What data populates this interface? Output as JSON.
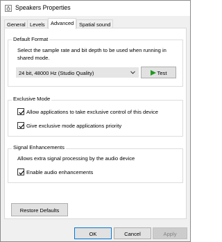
{
  "window": {
    "title": "Speakers Properties"
  },
  "tabs": [
    {
      "label": "General",
      "active": false
    },
    {
      "label": "Levels",
      "active": false
    },
    {
      "label": "Advanced",
      "active": true
    },
    {
      "label": "Spatial sound",
      "active": false
    }
  ],
  "default_format": {
    "title": "Default Format",
    "description": "Select the sample rate and bit depth to be used when running in shared mode.",
    "selected_format": "24 bit, 48000 Hz (Studio Quality)",
    "test_label": "Test"
  },
  "exclusive_mode": {
    "title": "Exclusive Mode",
    "options": [
      {
        "label": "Allow applications to take exclusive control of this device",
        "checked": true
      },
      {
        "label": "Give exclusive mode applications priority",
        "checked": true
      }
    ]
  },
  "signal_enhancements": {
    "title": "Signal Enhancements",
    "description": "Allows extra signal processing by the audio device",
    "option": {
      "label": "Enable audio enhancements",
      "checked": true
    }
  },
  "restore_defaults_label": "Restore Defaults",
  "footer": {
    "ok_label": "OK",
    "cancel_label": "Cancel",
    "apply_label": "Apply"
  },
  "colors": {
    "accent": "#0078d7",
    "play_icon": "#1f9a1f"
  }
}
